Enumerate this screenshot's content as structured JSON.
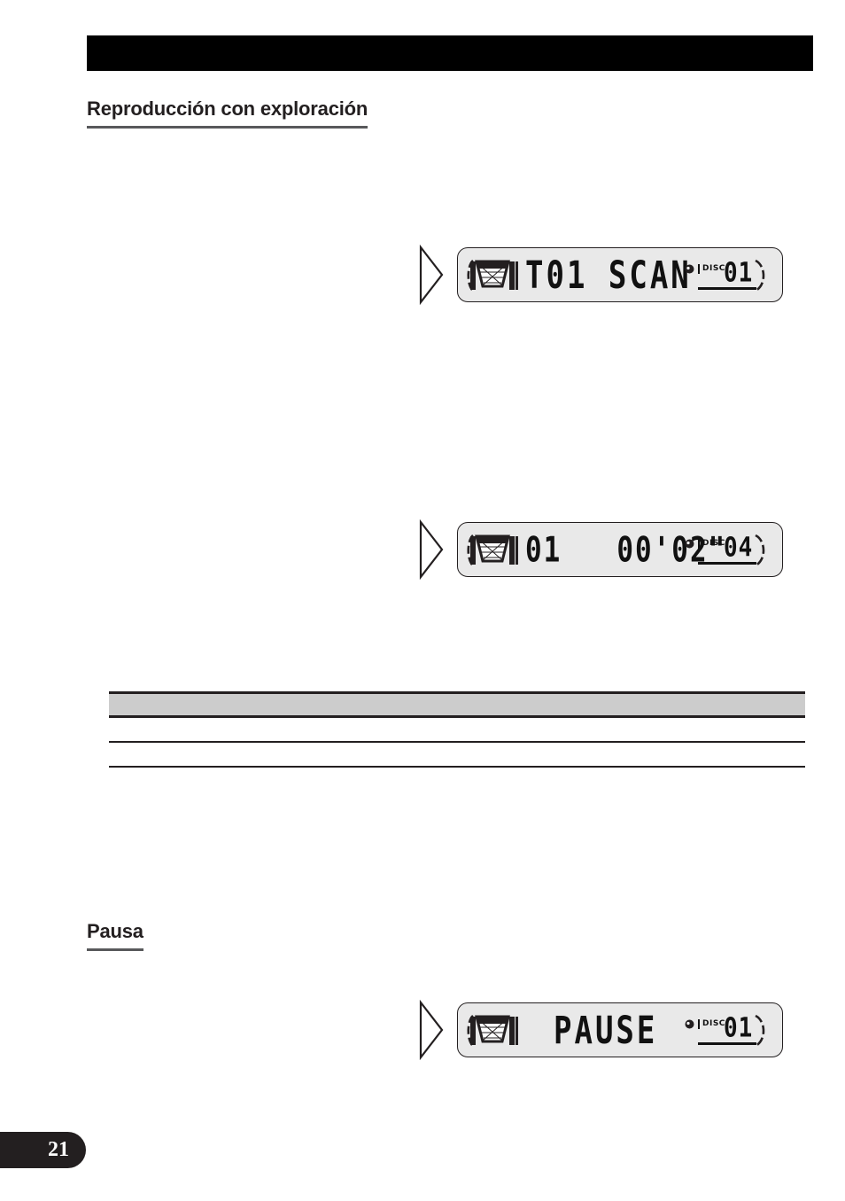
{
  "document": {
    "page_number": "21",
    "language": "es",
    "header_bar_title": ""
  },
  "sections": [
    {
      "id": "scan",
      "heading": "Reproducción con exploración",
      "body": ""
    },
    {
      "id": "pause",
      "heading": "Pausa",
      "body": ""
    }
  ],
  "figures": [
    {
      "id": "lcd-scan",
      "pointer_icon": "play-triangle-icon",
      "magazine_icon": "cd-magazine-icon",
      "readout": "T01 SCAN",
      "disc_bullet_icon": "disc-indicator-icon",
      "disc_label": "DISC",
      "disc_number": "01"
    },
    {
      "id": "lcd-track-time",
      "pointer_icon": "play-triangle-icon",
      "magazine_icon": "cd-magazine-icon",
      "readout": "01   00'02\"",
      "disc_bullet_icon": "disc-indicator-icon",
      "disc_label": "DISC",
      "disc_number": "04"
    },
    {
      "id": "lcd-pause",
      "pointer_icon": "play-triangle-icon",
      "magazine_icon": "cd-magazine-icon",
      "readout": "PAUSE",
      "disc_bullet_icon": "disc-indicator-icon",
      "disc_label": "DISC",
      "disc_number": "01"
    }
  ],
  "note_table": {
    "header_cells": [
      ""
    ],
    "rows": [
      [
        ""
      ],
      [
        ""
      ]
    ]
  },
  "colors": {
    "ink": "#231f20",
    "rule": "#58595b",
    "table_header_fill": "#cccccc",
    "lcd_panel_fill": "#e9e9e9",
    "header_bar": "#000000"
  }
}
